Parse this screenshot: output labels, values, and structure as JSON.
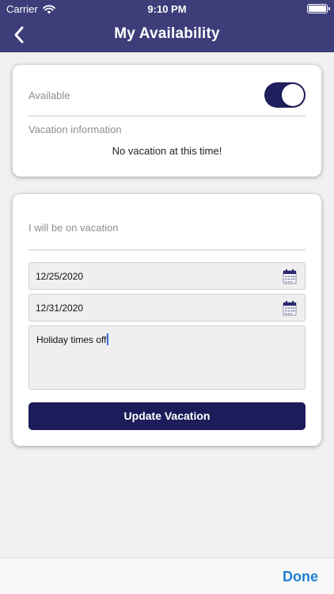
{
  "status_bar": {
    "carrier": "Carrier",
    "time": "9:10 PM",
    "wifi_icon": "wifi-icon",
    "battery_icon": "battery-icon"
  },
  "nav": {
    "title": "My Availability",
    "back_icon": "chevron-left-icon",
    "background": "#3d3d7a"
  },
  "availability_card": {
    "available_label": "Available",
    "available_toggle_on": true,
    "vacation_info_label": "Vacation information",
    "vacation_message": "No vacation at this time!"
  },
  "vacation_form": {
    "heading": "I will be on vacation",
    "start_date": "12/25/2020",
    "end_date": "12/31/2020",
    "calendar_icon": "calendar-icon",
    "notes": "Holiday times off",
    "update_button": "Update Vacation",
    "button_color": "#1c1c5a"
  },
  "footer": {
    "done_label": "Done",
    "done_color": "#1f7fd6"
  }
}
